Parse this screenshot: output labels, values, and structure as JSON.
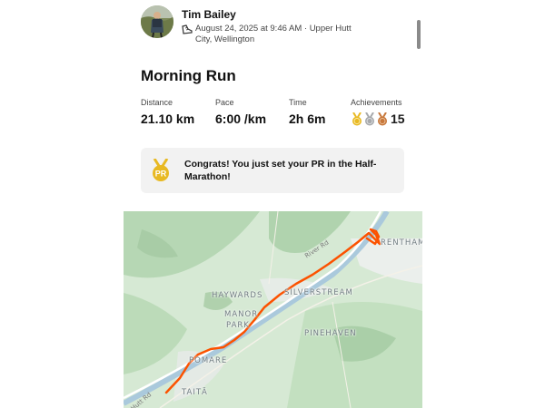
{
  "activity": {
    "athlete_name": "Tim Bailey",
    "meta": "August 24, 2025 at 9:46 AM · Upper Hutt City, Wellington",
    "title": "Morning Run"
  },
  "stats": {
    "distance": {
      "label": "Distance",
      "value": "21.10 km"
    },
    "pace": {
      "label": "Pace",
      "value": "6:00 /km"
    },
    "time": {
      "label": "Time",
      "value": "2h 6m"
    },
    "achievements": {
      "label": "Achievements",
      "value": "15"
    }
  },
  "pr_card": {
    "badge": "PR",
    "message": "Congrats! You just set your PR in the Half-Marathon!"
  },
  "map": {
    "places": {
      "trentham": "RENTHAM",
      "haywards": "HAYWARDS",
      "silverstream": "SILVERSTREAM",
      "manor": "MANOR",
      "park": "PARK",
      "pinehaven": "PINEHAVEN",
      "pomare": "POMARE",
      "taita": "TAITĀ"
    },
    "roads": {
      "river_rd": "River Rd",
      "hutt_rd": "Hutt Rd"
    },
    "route_color": "#fc5200"
  },
  "colors": {
    "gold": "#e8b923",
    "silver": "#a7a9ac",
    "bronze": "#c7773a",
    "accent": "#fc5200"
  },
  "icons": {
    "avatar": "athlete-photo",
    "shoe": "shoe-icon",
    "medals": [
      "gold-medal-icon",
      "silver-medal-icon",
      "bronze-medal-icon"
    ],
    "pr": "pr-badge-icon"
  }
}
